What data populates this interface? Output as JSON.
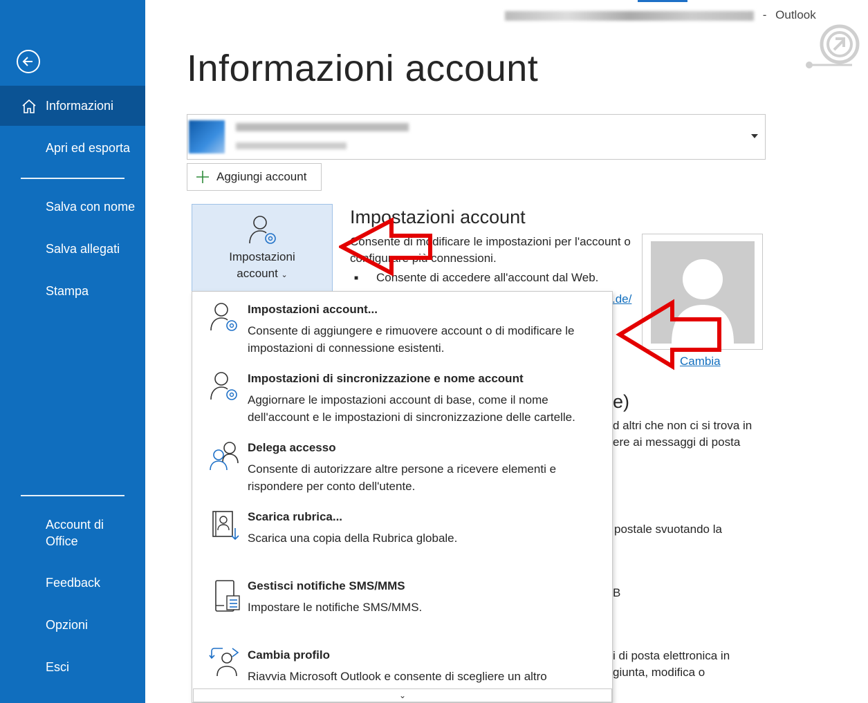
{
  "titlebar": {
    "app_name": "Outlook",
    "separator": "-"
  },
  "sidebar": {
    "items": [
      {
        "label": "Informazioni"
      },
      {
        "label": "Apri ed esporta"
      },
      {
        "label": "Salva con nome"
      },
      {
        "label": "Salva allegati"
      },
      {
        "label": "Stampa"
      },
      {
        "label": "Account di Office"
      },
      {
        "label": "Feedback"
      },
      {
        "label": "Opzioni"
      },
      {
        "label": "Esci"
      }
    ]
  },
  "main": {
    "title": "Informazioni account",
    "add_account_label": "Aggiungi account",
    "account_settings_button": {
      "line1": "Impostazioni",
      "line2": "account",
      "caret": "⌄"
    },
    "section": {
      "title": "Impostazioni account",
      "description": "Consente di modificare le impostazioni per l'account o configurare più connessioni.",
      "bullet_symbol": "■",
      "bullet_text": "Consente di accedere all'account dal Web.",
      "link_partial": ".de/"
    },
    "change_photo_label": "Cambia",
    "background_fragments": [
      "e)",
      "d altri che non ci si trova in",
      "ere ai messaggi di posta",
      "postale svuotando la",
      "B",
      "i di posta elettronica in",
      "giunta, modifica o"
    ]
  },
  "menu": {
    "items": [
      {
        "title": "Impostazioni account...",
        "desc": "Consente di aggiungere e rimuovere account o di modificare le impostazioni di connessione esistenti.",
        "icon": "person-gear-icon"
      },
      {
        "title": "Impostazioni di sincronizzazione e nome account",
        "desc": "Aggiornare le impostazioni account di base, come il nome dell'account e le impostazioni di sincronizzazione delle cartelle.",
        "icon": "person-gear-icon"
      },
      {
        "title": "Delega accesso",
        "desc": "Consente di autorizzare altre persone a ricevere elementi e rispondere per conto dell'utente.",
        "icon": "people-icon"
      },
      {
        "title": "Scarica rubrica...",
        "desc": "Scarica una copia della Rubrica globale.",
        "icon": "address-book-download-icon"
      },
      {
        "title": "Gestisci notifiche SMS/MMS",
        "desc": "Impostare le notifiche SMS/MMS.",
        "icon": "mobile-notification-icon"
      },
      {
        "title": "Cambia profilo",
        "desc": "Riavvia Microsoft Outlook e consente di scegliere un altro",
        "icon": "switch-profile-icon"
      }
    ],
    "scroll_down_glyph": "⌄"
  },
  "colors": {
    "sidebar_bg": "#106ebe",
    "sidebar_active": "#0b5394",
    "link": "#106ebe",
    "annotation_arrow": "#e30000",
    "button_selected_bg": "#dde9f7"
  }
}
